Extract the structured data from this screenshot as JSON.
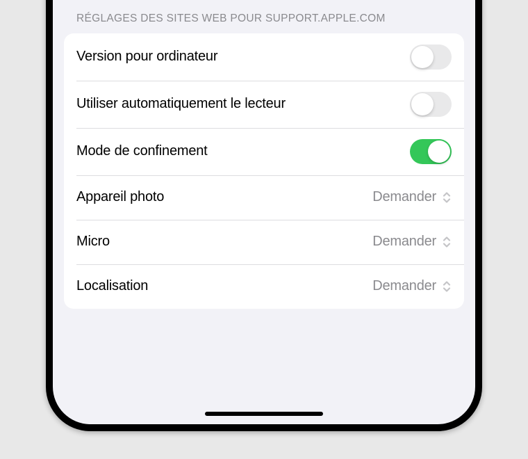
{
  "section_header": "RÉGLAGES DES SITES WEB POUR SUPPORT.APPLE.COM",
  "rows": {
    "desktop": {
      "label": "Version pour ordinateur",
      "on": false
    },
    "reader": {
      "label": "Utiliser automatiquement le lecteur",
      "on": false
    },
    "lockdown": {
      "label": "Mode de confinement",
      "on": true
    },
    "camera": {
      "label": "Appareil photo",
      "value": "Demander"
    },
    "microphone": {
      "label": "Micro",
      "value": "Demander"
    },
    "location": {
      "label": "Localisation",
      "value": "Demander"
    }
  }
}
